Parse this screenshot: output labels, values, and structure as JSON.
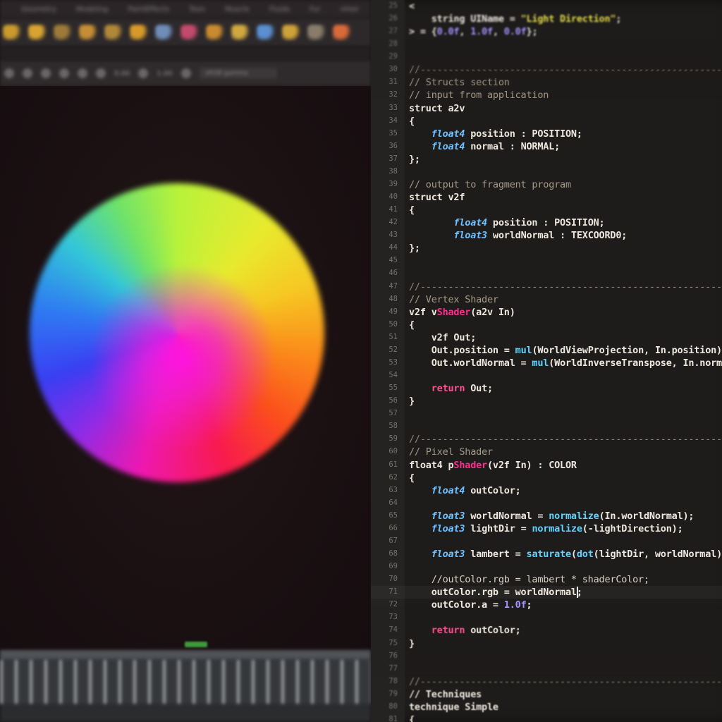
{
  "viewport_app": {
    "shelf_tabs": [
      "Geometry",
      "Modeling",
      "PaintEffects",
      "Toon",
      "Muscle",
      "Fluids",
      "Fur",
      "nHair"
    ],
    "shelf_tool_icons": [
      {
        "icon": "tool-icon",
        "color": "#c99a2e"
      },
      {
        "icon": "tool-icon",
        "color": "#d8a431"
      },
      {
        "icon": "tool-icon",
        "color": "#9e7a3a"
      },
      {
        "icon": "tool-icon",
        "color": "#c48e35"
      },
      {
        "icon": "tool-icon",
        "color": "#b08838"
      },
      {
        "icon": "tool-icon",
        "color": "#d79a2a"
      },
      {
        "icon": "tool-icon",
        "color": "#6f8db8"
      },
      {
        "icon": "tool-icon",
        "color": "#c24a6a"
      },
      {
        "icon": "tool-icon",
        "color": "#c98a30"
      },
      {
        "icon": "tool-icon",
        "color": "#d0a840"
      },
      {
        "icon": "tool-icon",
        "color": "#5b8fd0"
      },
      {
        "icon": "tool-icon",
        "color": "#cda238"
      },
      {
        "icon": "tool-icon",
        "color": "#8a7c6a"
      },
      {
        "icon": "tool-icon",
        "color": "#d86a3a"
      }
    ],
    "viewport_toolbar": {
      "value_1": "0.00",
      "value_2": "1.00",
      "dropdown": "sRGB gamma"
    },
    "preview": {
      "object": "normal-shaded sphere",
      "colors": [
        "#b8f23a",
        "#f6c823",
        "#fb4e1c",
        "#ee18b0",
        "#3a3ef2",
        "#33c7d8"
      ]
    },
    "timeline_marker_color": "#3e9a3a"
  },
  "editor": {
    "colors": {
      "background": "#1e1c1b",
      "type_keyword": "#6ec2ff",
      "return_keyword": "#ff4f92",
      "function": "#5fd4ff",
      "number": "#a594ff",
      "string": "#e8de4a",
      "comment": "#a49a88"
    },
    "lines": [
      {
        "n": "25",
        "segs": [
          [
            "p",
            "<"
          ]
        ]
      },
      {
        "n": "26",
        "segs": [
          [
            "p",
            "    string UIName = "
          ],
          [
            "str",
            "\"Light Direction\""
          ],
          [
            "p",
            ";"
          ]
        ]
      },
      {
        "n": "27",
        "segs": [
          [
            "p",
            "> = {"
          ],
          [
            "num",
            "0.0f"
          ],
          [
            "p",
            ", "
          ],
          [
            "num",
            "1.0f"
          ],
          [
            "p",
            ", "
          ],
          [
            "num",
            "0.0f"
          ],
          [
            "p",
            "};"
          ]
        ]
      },
      {
        "n": "28",
        "segs": []
      },
      {
        "n": "29",
        "segs": []
      },
      {
        "n": "30",
        "segs": [
          [
            "sep",
            "//------------------------------------------------------------------"
          ]
        ]
      },
      {
        "n": "31",
        "segs": [
          [
            "cm",
            "// Structs section"
          ]
        ]
      },
      {
        "n": "32",
        "segs": [
          [
            "cm",
            "// input from application"
          ]
        ]
      },
      {
        "n": "33",
        "segs": [
          [
            "p",
            "struct a2v"
          ]
        ]
      },
      {
        "n": "34",
        "segs": [
          [
            "p",
            "{"
          ]
        ]
      },
      {
        "n": "35",
        "segs": [
          [
            "p",
            "    "
          ],
          [
            "kw",
            "float4"
          ],
          [
            "p",
            " position : POSITION;"
          ]
        ]
      },
      {
        "n": "36",
        "segs": [
          [
            "p",
            "    "
          ],
          [
            "kw",
            "float4"
          ],
          [
            "p",
            " normal : NORMAL;"
          ]
        ]
      },
      {
        "n": "37",
        "segs": [
          [
            "p",
            "};"
          ]
        ]
      },
      {
        "n": "38",
        "segs": []
      },
      {
        "n": "39",
        "segs": [
          [
            "cm",
            "// output to fragment program"
          ]
        ]
      },
      {
        "n": "40",
        "segs": [
          [
            "p",
            "struct v2f"
          ]
        ]
      },
      {
        "n": "41",
        "segs": [
          [
            "p",
            "{"
          ]
        ]
      },
      {
        "n": "42",
        "segs": [
          [
            "p",
            "        "
          ],
          [
            "kw",
            "float4"
          ],
          [
            "p",
            " position : POSITION;"
          ]
        ]
      },
      {
        "n": "43",
        "segs": [
          [
            "p",
            "        "
          ],
          [
            "kw",
            "float3"
          ],
          [
            "p",
            " worldNormal : TEXCOORD0;"
          ]
        ]
      },
      {
        "n": "44",
        "segs": [
          [
            "p",
            "};"
          ]
        ]
      },
      {
        "n": "45",
        "segs": []
      },
      {
        "n": "46",
        "segs": []
      },
      {
        "n": "47",
        "segs": [
          [
            "sep",
            "//------------------------------------------------------------------"
          ]
        ]
      },
      {
        "n": "48",
        "segs": [
          [
            "cm",
            "// Vertex Shader"
          ]
        ]
      },
      {
        "n": "49",
        "segs": [
          [
            "p",
            "v2f v"
          ],
          [
            "mg",
            "Shader"
          ],
          [
            "p",
            "(a2v In)"
          ]
        ]
      },
      {
        "n": "50",
        "segs": [
          [
            "p",
            "{"
          ]
        ]
      },
      {
        "n": "51",
        "segs": [
          [
            "p",
            "    v2f Out;"
          ]
        ]
      },
      {
        "n": "52",
        "segs": [
          [
            "p",
            "    Out.position = "
          ],
          [
            "fn",
            "mul"
          ],
          [
            "p",
            "(WorldViewProjection, In.position);"
          ]
        ]
      },
      {
        "n": "53",
        "segs": [
          [
            "p",
            "    Out.worldNormal = "
          ],
          [
            "fn",
            "mul"
          ],
          [
            "p",
            "(WorldInverseTranspose, In.normal);"
          ]
        ]
      },
      {
        "n": "54",
        "segs": []
      },
      {
        "n": "55",
        "segs": [
          [
            "p",
            "    "
          ],
          [
            "ret",
            "return"
          ],
          [
            "p",
            " Out;"
          ]
        ]
      },
      {
        "n": "56",
        "segs": [
          [
            "p",
            "}"
          ]
        ]
      },
      {
        "n": "57",
        "segs": []
      },
      {
        "n": "58",
        "segs": []
      },
      {
        "n": "59",
        "segs": [
          [
            "sep",
            "//------------------------------------------------------------------"
          ]
        ]
      },
      {
        "n": "60",
        "segs": [
          [
            "cm",
            "// Pixel Shader"
          ]
        ]
      },
      {
        "n": "61",
        "segs": [
          [
            "p",
            "float4 p"
          ],
          [
            "mg",
            "Shader"
          ],
          [
            "p",
            "(v2f In) : COLOR"
          ]
        ]
      },
      {
        "n": "62",
        "segs": [
          [
            "p",
            "{"
          ]
        ]
      },
      {
        "n": "63",
        "segs": [
          [
            "p",
            "    "
          ],
          [
            "kw",
            "float4"
          ],
          [
            "p",
            " outColor;"
          ]
        ]
      },
      {
        "n": "64",
        "segs": []
      },
      {
        "n": "65",
        "segs": [
          [
            "p",
            "    "
          ],
          [
            "kw",
            "float3"
          ],
          [
            "p",
            " worldNormal = "
          ],
          [
            "fn",
            "normalize"
          ],
          [
            "p",
            "(In.worldNormal);"
          ]
        ]
      },
      {
        "n": "66",
        "segs": [
          [
            "p",
            "    "
          ],
          [
            "kw",
            "float3"
          ],
          [
            "p",
            " lightDir = "
          ],
          [
            "fn",
            "normalize"
          ],
          [
            "p",
            "(-lightDirection);"
          ]
        ]
      },
      {
        "n": "67",
        "segs": []
      },
      {
        "n": "68",
        "segs": [
          [
            "p",
            "    "
          ],
          [
            "kw",
            "float3"
          ],
          [
            "p",
            " lambert = "
          ],
          [
            "fn",
            "saturate"
          ],
          [
            "p",
            "("
          ],
          [
            "fn",
            "dot"
          ],
          [
            "p",
            "(lightDir, worldNormal));"
          ]
        ]
      },
      {
        "n": "69",
        "segs": []
      },
      {
        "n": "70",
        "segs": [
          [
            "cm2",
            "    //outColor.rgb = lambert * shaderColor;"
          ]
        ]
      },
      {
        "n": "71",
        "segs": [
          [
            "p",
            "    outColor.rgb = worldNormal;"
          ]
        ],
        "active": true,
        "caret_after": "    outColor.rgb = worldNormal"
      },
      {
        "n": "72",
        "segs": [
          [
            "p",
            "    outColor.a = "
          ],
          [
            "num",
            "1.0f"
          ],
          [
            "p",
            ";"
          ]
        ]
      },
      {
        "n": "73",
        "segs": []
      },
      {
        "n": "74",
        "segs": [
          [
            "p",
            "    "
          ],
          [
            "ret",
            "return"
          ],
          [
            "p",
            " outColor;"
          ]
        ]
      },
      {
        "n": "75",
        "segs": [
          [
            "p",
            "}"
          ]
        ]
      },
      {
        "n": "76",
        "segs": []
      },
      {
        "n": "77",
        "segs": []
      },
      {
        "n": "78",
        "segs": [
          [
            "sep",
            "//------------------------------------------------------------------"
          ]
        ]
      },
      {
        "n": "79",
        "segs": [
          [
            "p",
            "// Techniques"
          ]
        ]
      },
      {
        "n": "80",
        "segs": [
          [
            "p",
            "technique Simple"
          ]
        ]
      },
      {
        "n": "81",
        "segs": [
          [
            "p",
            "{"
          ]
        ]
      }
    ]
  }
}
